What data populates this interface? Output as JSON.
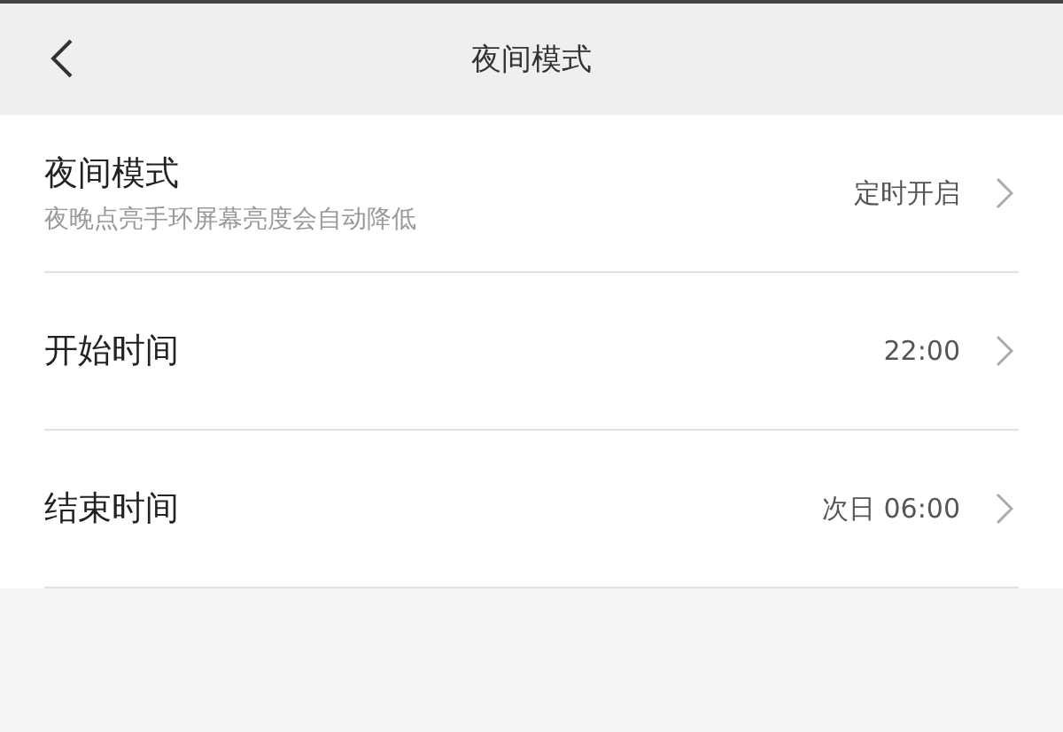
{
  "header": {
    "title": "夜间模式"
  },
  "settings": [
    {
      "label": "夜间模式",
      "description": "夜晚点亮手环屏幕亮度会自动降低",
      "value": "定时开启"
    },
    {
      "label": "开始时间",
      "value": "22:00"
    },
    {
      "label": "结束时间",
      "value": "次日 06:00"
    }
  ]
}
